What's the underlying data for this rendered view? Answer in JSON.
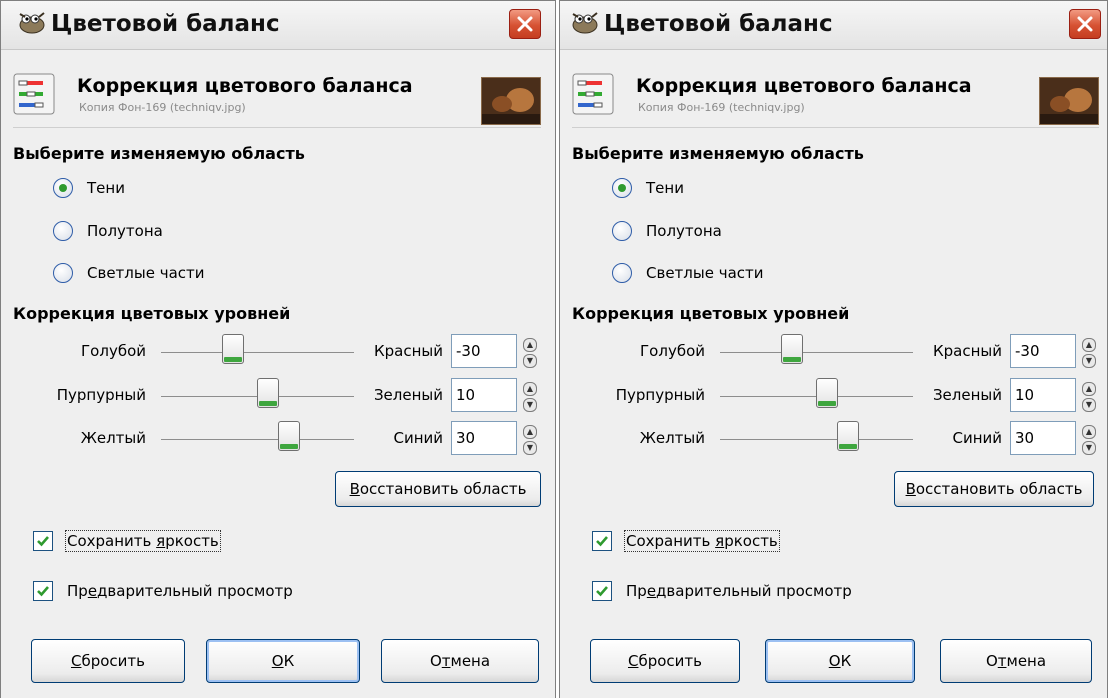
{
  "colors": {
    "accent": "#2f9a2f",
    "close_button": "#d65233",
    "border": "#003c74"
  },
  "dialogs": [
    {
      "title": "Цветовой баланс",
      "title_icon": "wilber-icon",
      "close_icon": "close-icon",
      "header": {
        "title": "Коррекция цветового баланса",
        "subtitle": "Копия Фон-169 (techniqv.jpg)",
        "icon": "color-balance-icon",
        "thumbnail": "image-thumbnail"
      },
      "range_section": {
        "label": "Выберите изменяемую область",
        "options": [
          {
            "label": "Тени",
            "checked": true
          },
          {
            "label": "Полутона",
            "checked": false
          },
          {
            "label": "Светлые части",
            "checked": false
          }
        ]
      },
      "levels_section": {
        "label": "Коррекция цветовых уровней",
        "rows": [
          {
            "left": "Голубой",
            "right": "Красный",
            "value": "-30"
          },
          {
            "left": "Пурпурный",
            "right": "Зеленый",
            "value": "10"
          },
          {
            "left": "Желтый",
            "right": "Синий",
            "value": "30"
          }
        ]
      },
      "reset_range": {
        "mnemonic": "В",
        "rest": "осстановить область"
      },
      "preserve": {
        "before": "Сохранить ",
        "mnemonic": "я",
        "after": "ркость",
        "checked": true
      },
      "preview": {
        "before": "Пр",
        "mnemonic": "е",
        "after": "дварительный просмотр",
        "checked": true
      },
      "buttons": {
        "reset": {
          "mnemonic": "С",
          "rest": "бросить"
        },
        "ok": {
          "mnemonic": "О",
          "rest": "К"
        },
        "cancel": {
          "before": "О",
          "mnemonic": "т",
          "after": "мена"
        }
      }
    },
    {
      "title": "Цветовой баланс",
      "title_icon": "wilber-icon",
      "close_icon": "close-icon",
      "header": {
        "title": "Коррекция цветового баланса",
        "subtitle": "Копия Фон-169 (techniqv.jpg)",
        "icon": "color-balance-icon",
        "thumbnail": "image-thumbnail"
      },
      "range_section": {
        "label": "Выберите изменяемую область",
        "options": [
          {
            "label": "Тени",
            "checked": true
          },
          {
            "label": "Полутона",
            "checked": false
          },
          {
            "label": "Светлые части",
            "checked": false
          }
        ]
      },
      "levels_section": {
        "label": "Коррекция цветовых уровней",
        "rows": [
          {
            "left": "Голубой",
            "right": "Красный",
            "value": "-30"
          },
          {
            "left": "Пурпурный",
            "right": "Зеленый",
            "value": "10"
          },
          {
            "left": "Желтый",
            "right": "Синий",
            "value": "30"
          }
        ]
      },
      "reset_range": {
        "mnemonic": "В",
        "rest": "осстановить область"
      },
      "preserve": {
        "before": "Сохранить ",
        "mnemonic": "я",
        "after": "ркость",
        "checked": true
      },
      "preview": {
        "before": "Пр",
        "mnemonic": "е",
        "after": "дварительный просмотр",
        "checked": true
      },
      "buttons": {
        "reset": {
          "mnemonic": "С",
          "rest": "бросить"
        },
        "ok": {
          "mnemonic": "О",
          "rest": "К"
        },
        "cancel": {
          "before": "О",
          "mnemonic": "т",
          "after": "мена"
        }
      }
    }
  ]
}
